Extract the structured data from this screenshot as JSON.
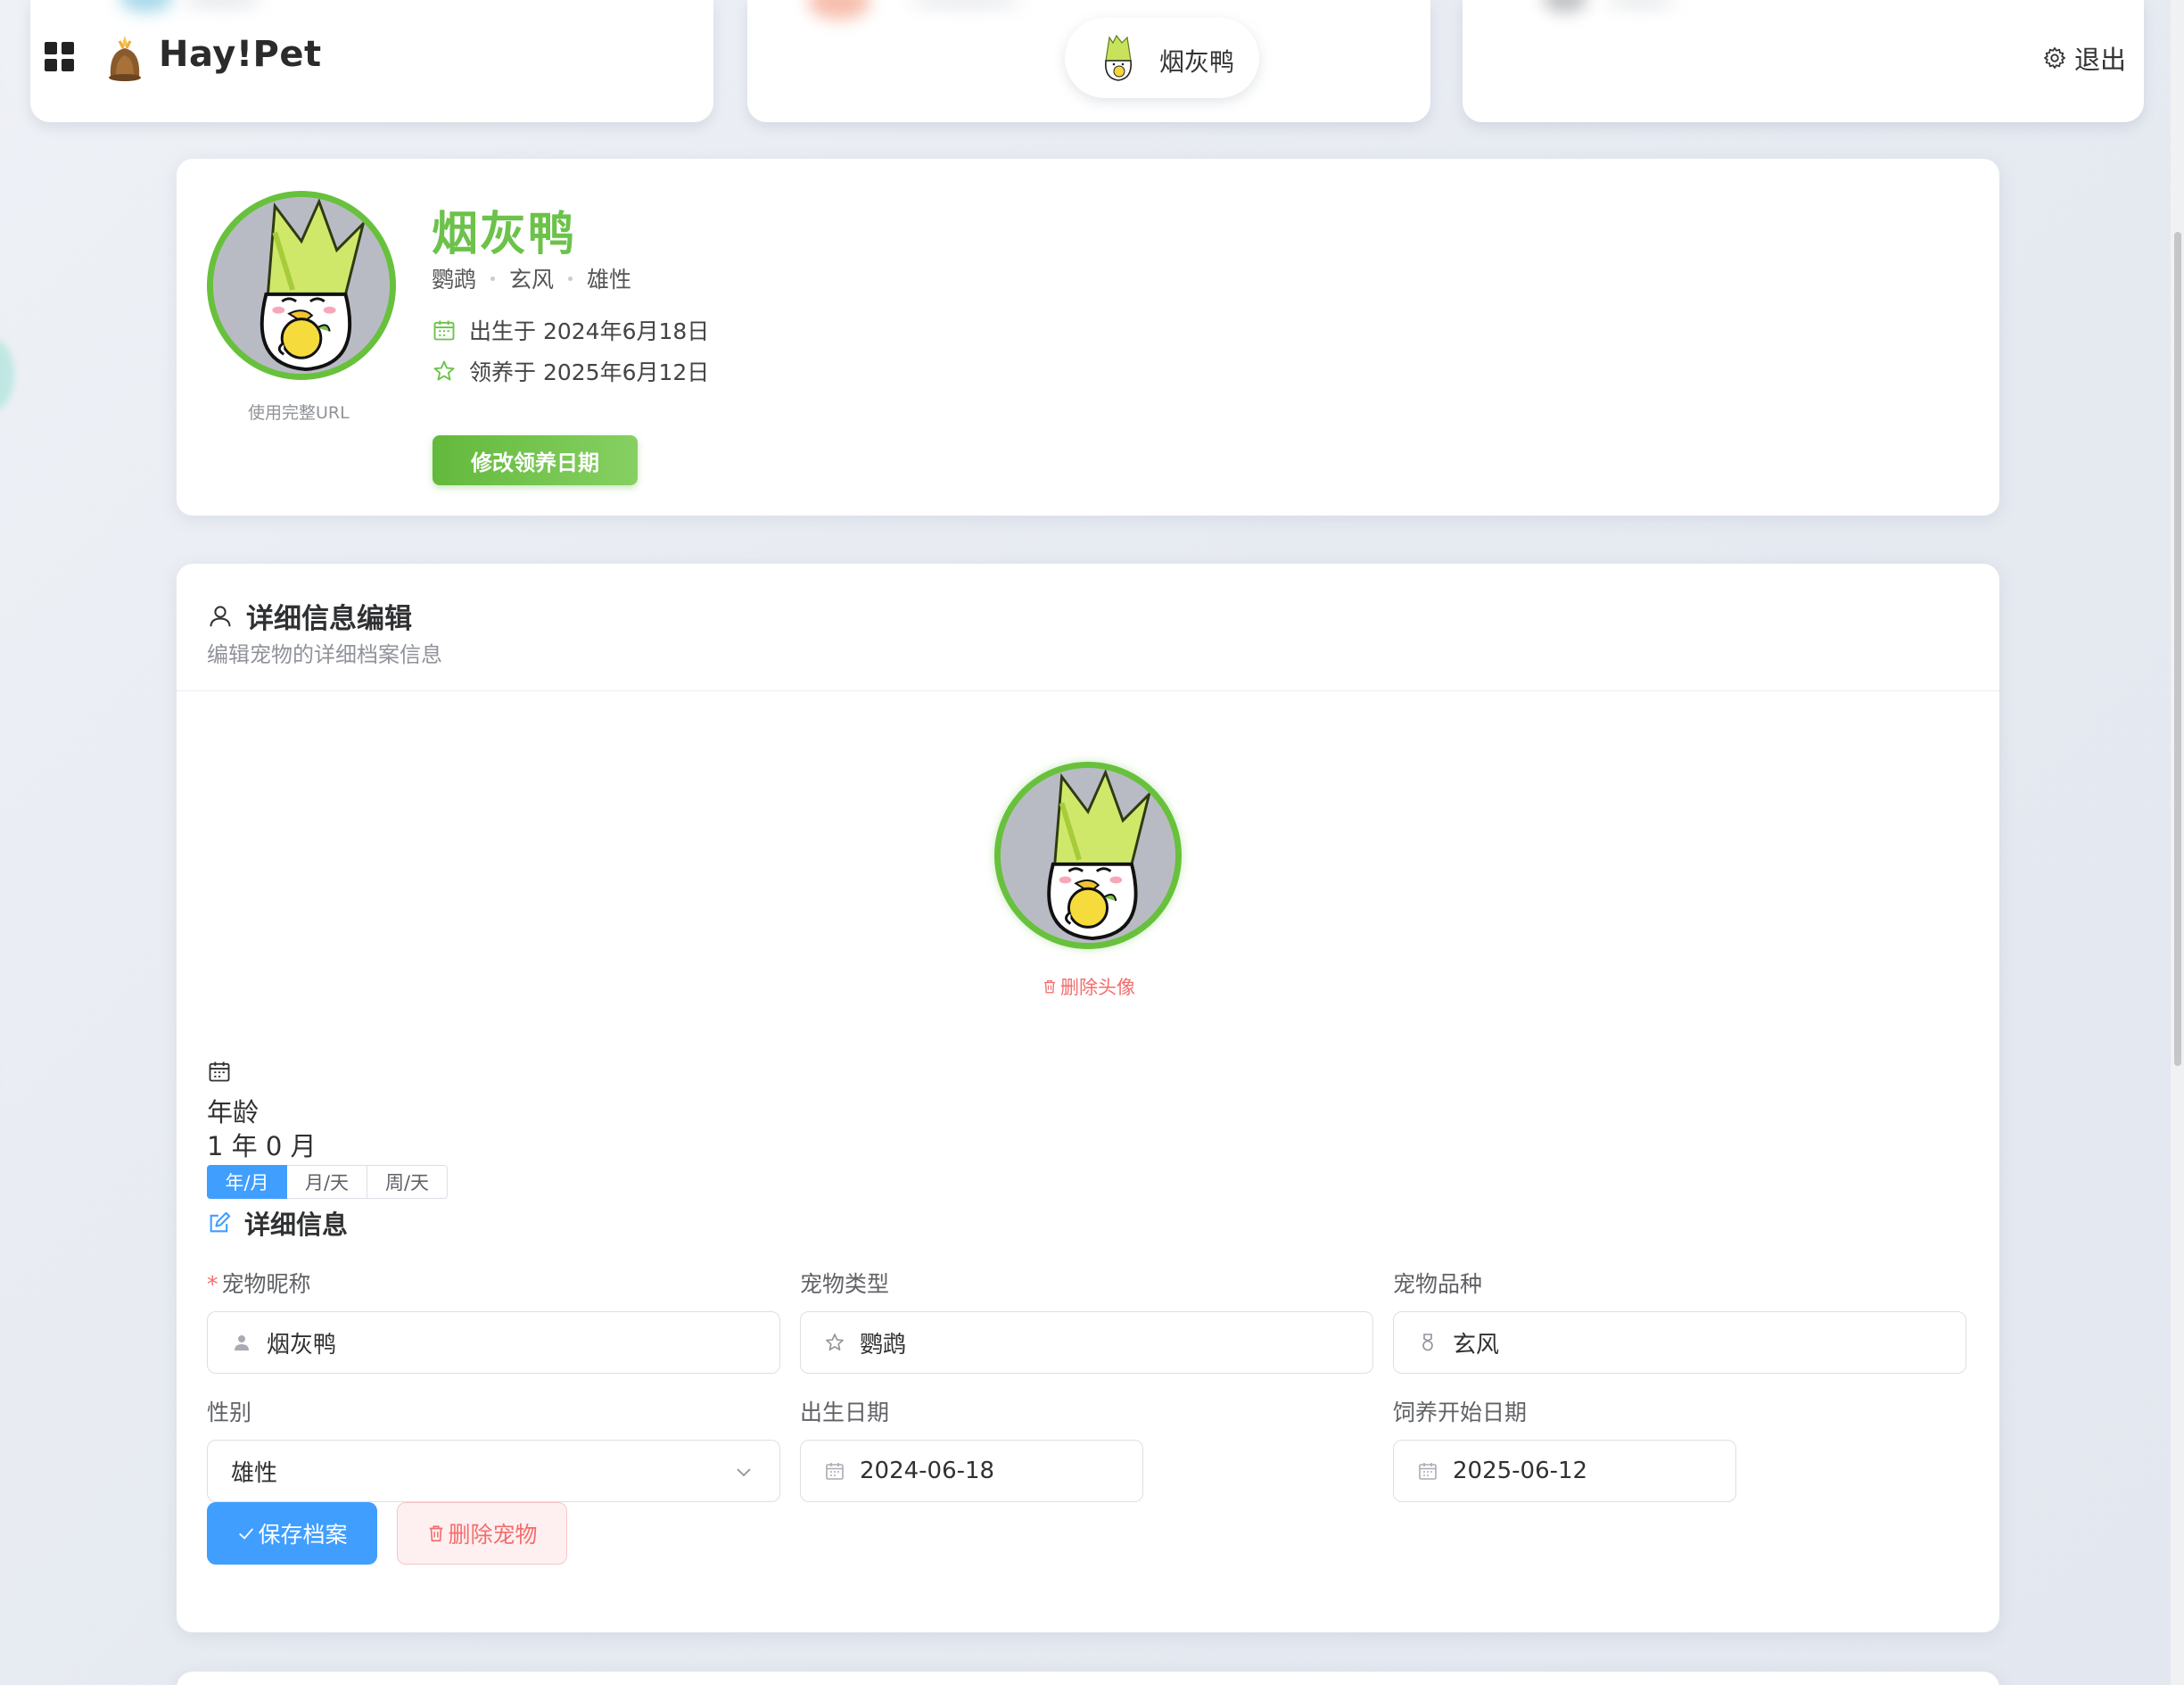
{
  "header": {
    "brand": "Hay!Pet",
    "current_pet": "烟灰鸭",
    "logout": "退出"
  },
  "profile": {
    "name": "烟灰鸭",
    "tags": [
      "鹦鹉",
      "玄风",
      "雄性"
    ],
    "birth_text": "出生于 2024年6月18日",
    "adopt_text": "领养于 2025年6月12日",
    "url_hint": "使用完整URL",
    "edit_adopt_button": "修改领养日期"
  },
  "detail": {
    "title": "详细信息编辑",
    "subtitle": "编辑宠物的详细档案信息",
    "delete_avatar": "删除头像",
    "age_label": "年龄",
    "age_value": "1 年 0 月",
    "age_modes": [
      "年/月",
      "月/天",
      "周/天"
    ],
    "age_mode_active": "年/月",
    "info_title": "详细信息",
    "fields": {
      "nickname_label": "宠物昵称",
      "nickname_value": "烟灰鸭",
      "type_label": "宠物类型",
      "type_value": "鹦鹉",
      "breed_label": "宠物品种",
      "breed_value": "玄风",
      "gender_label": "性别",
      "gender_value": "雄性",
      "birth_label": "出生日期",
      "birth_value": "2024-06-18",
      "feed_label": "饲养开始日期",
      "feed_value": "2025-06-12"
    },
    "save_button": "保存档案",
    "delete_button": "删除宠物"
  },
  "colors": {
    "accent_green": "#6cc24a",
    "primary_blue": "#409eff",
    "danger_red": "#f56c6c"
  }
}
